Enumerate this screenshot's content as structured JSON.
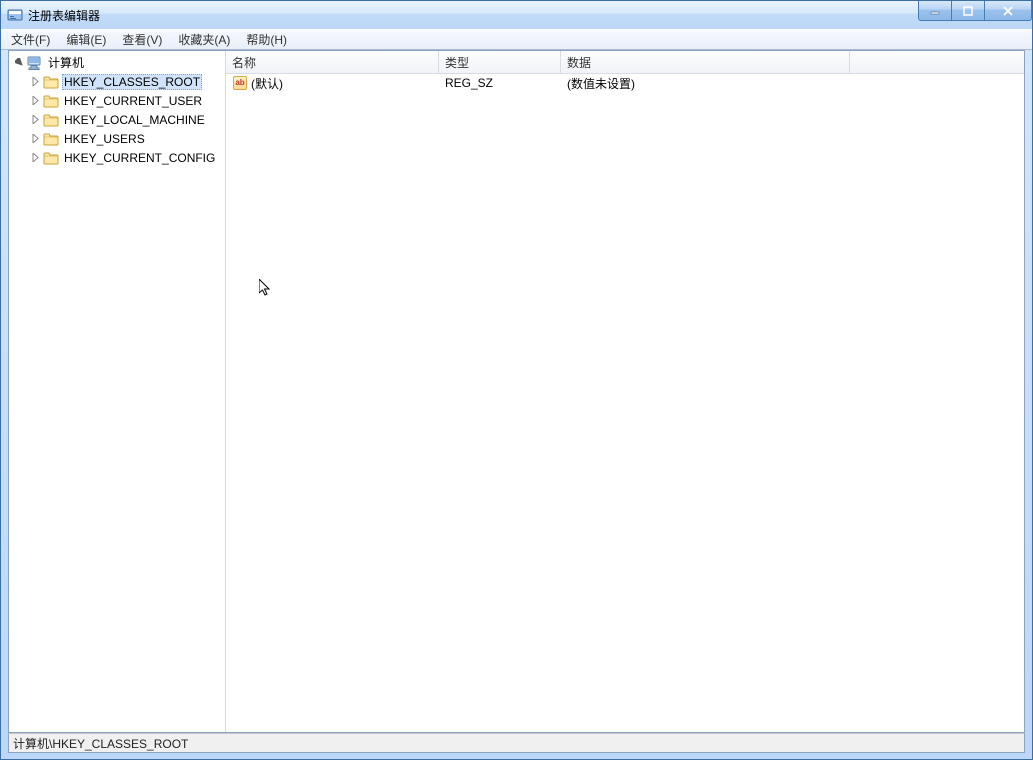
{
  "window": {
    "title": "注册表编辑器"
  },
  "menu": {
    "file": "文件(F)",
    "edit": "编辑(E)",
    "view": "查看(V)",
    "fav": "收藏夹(A)",
    "help": "帮助(H)"
  },
  "tree": {
    "root": "计算机",
    "nodes": [
      "HKEY_CLASSES_ROOT",
      "HKEY_CURRENT_USER",
      "HKEY_LOCAL_MACHINE",
      "HKEY_USERS",
      "HKEY_CURRENT_CONFIG"
    ],
    "selected_index": 0
  },
  "list": {
    "columns": {
      "name": "名称",
      "type": "类型",
      "data": "数据"
    },
    "rows": [
      {
        "name": "(默认)",
        "type": "REG_SZ",
        "data": "(数值未设置)"
      }
    ]
  },
  "status": {
    "path": "计算机\\HKEY_CLASSES_ROOT"
  },
  "col_widths": {
    "name": 213,
    "type": 122,
    "data": 289
  }
}
